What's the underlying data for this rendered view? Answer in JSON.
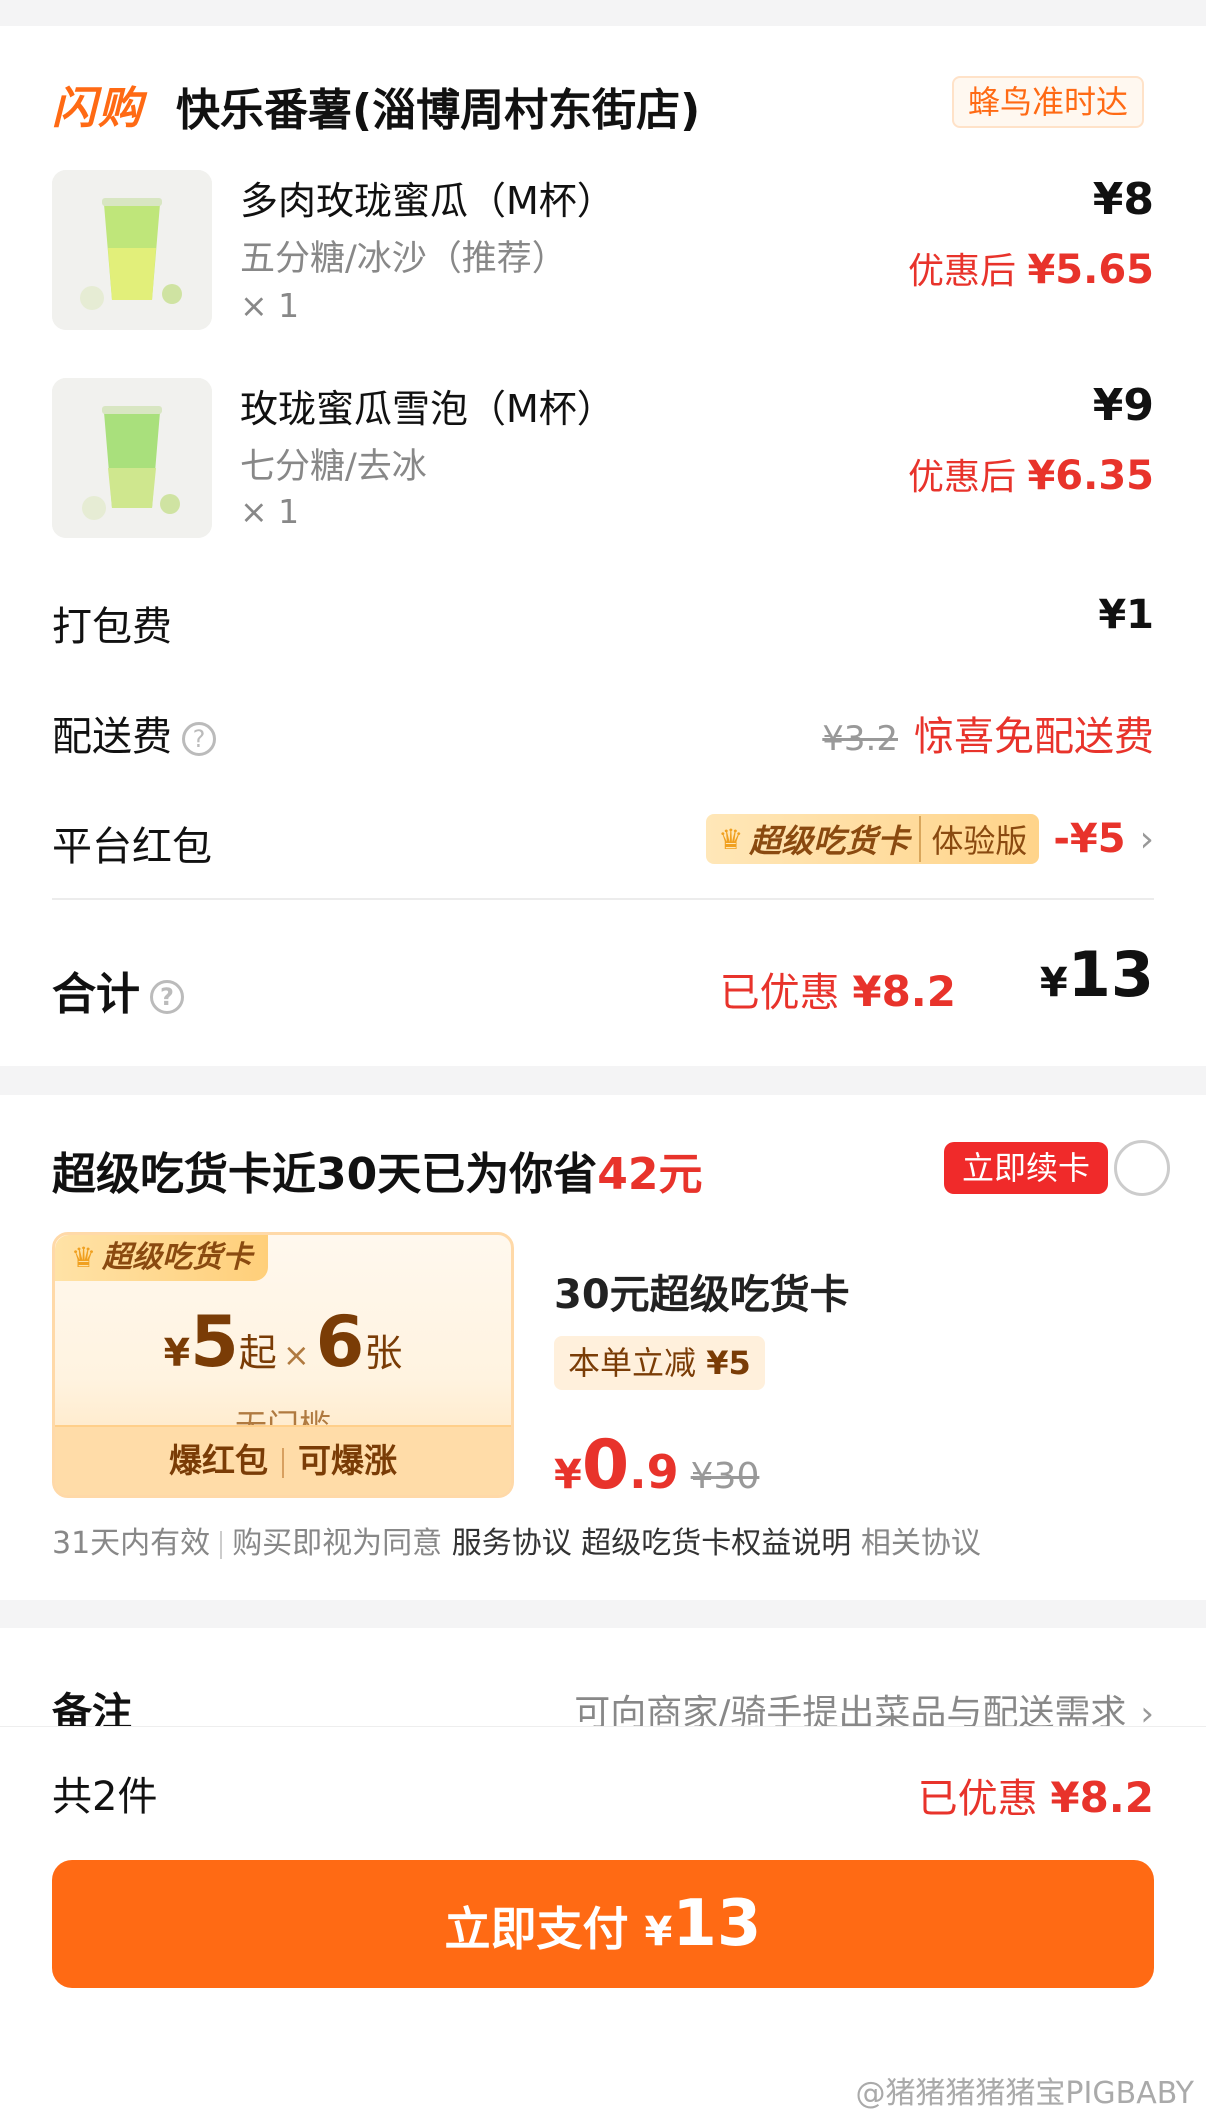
{
  "header": {
    "brand": "闪购",
    "shop_name": "快乐番薯(淄博周村东街店)",
    "delivery_tag": "蜂鸟准时达"
  },
  "products": [
    {
      "name": "多肉玫珑蜜瓜（M杯）",
      "spec": "五分糖/冰沙（推荐）",
      "qty": "× 1",
      "price": "¥8",
      "discount_prefix": "优惠后",
      "discount_price": "¥5.65"
    },
    {
      "name": "玫珑蜜瓜雪泡（M杯）",
      "spec": "七分糖/去冰",
      "qty": "× 1",
      "price": "¥9",
      "discount_prefix": "优惠后",
      "discount_price": "¥6.35"
    }
  ],
  "fees": {
    "packing_label": "打包费",
    "packing_value": "¥1",
    "delivery_label": "配送费",
    "delivery_original": "¥3.2",
    "delivery_value": "惊喜免配送费",
    "redpack_label": "平台红包",
    "redpack_badge": "超级吃货卡",
    "redpack_version": "体验版",
    "redpack_amount": "-¥5"
  },
  "total": {
    "label": "合计",
    "saved_prefix": "已优惠",
    "saved_amount": "¥8.2",
    "currency": "¥",
    "amount": "13"
  },
  "promo": {
    "title": "超级吃货卡近30天已为你省",
    "title_amount": "42元",
    "renew_label": "立即续卡",
    "coupon": {
      "tag": "超级吃货卡",
      "currency": "¥",
      "value": "5",
      "value_suffix": "起",
      "times": "×",
      "count": "6",
      "count_unit": "张",
      "condition": "无门槛",
      "feature_1": "爆红包",
      "feature_2": "可爆涨"
    },
    "card_name": "30元超级吃货卡",
    "reduce_prefix": "本单立减",
    "reduce_amount": "¥5",
    "price_currency": "¥",
    "price_int": "0",
    "price_dec": ".9",
    "price_original": "¥30",
    "terms_validity": "31天内有效",
    "terms_agree": "购买即视为同意",
    "terms_link_1": "服务协议",
    "terms_link_2": "超级吃货卡权益说明",
    "terms_link_3": "相关协议"
  },
  "note": {
    "label": "备注",
    "hint": "可向商家/骑手提出菜品与配送需求"
  },
  "bottom": {
    "count": "共2件",
    "saved_prefix": "已优惠",
    "saved_amount": "¥8.2",
    "pay_label": "立即支付",
    "pay_currency": "¥",
    "pay_amount": "13"
  },
  "watermark": "@猪猪猪猪猪宝PIGBABY",
  "colors": {
    "accent_orange": "#ff6a14",
    "discount_red": "#e8332b",
    "renew_red": "#f02a2a"
  }
}
